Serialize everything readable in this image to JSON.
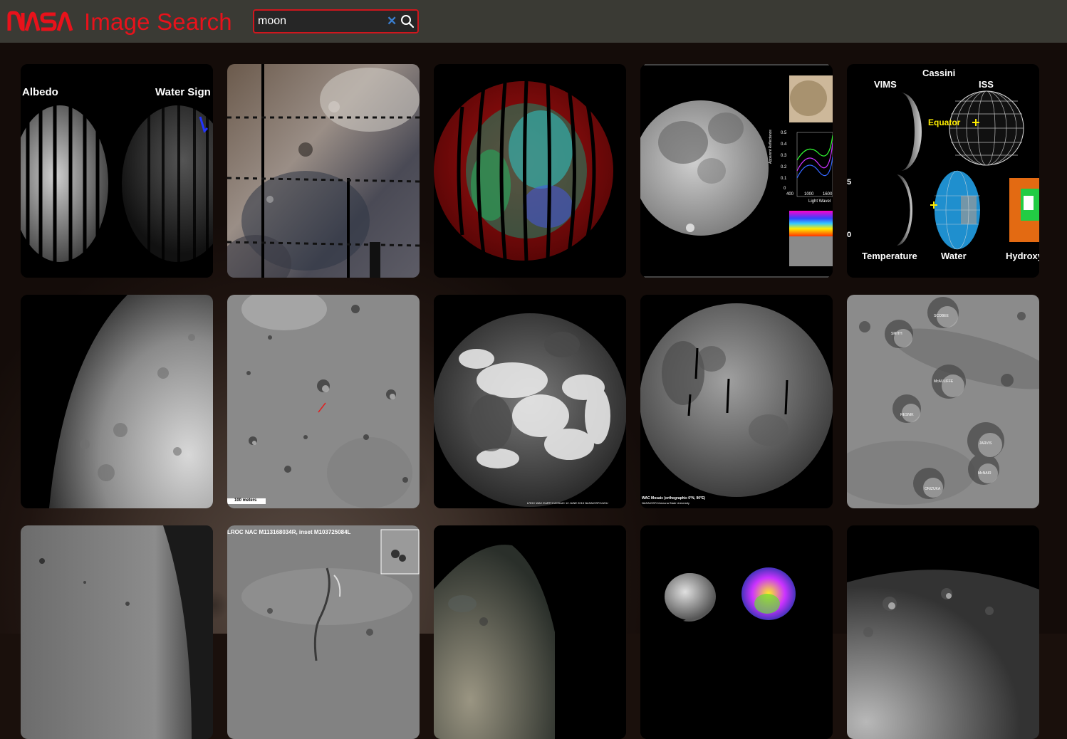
{
  "header": {
    "logo_text": "NASA",
    "title": "Image Search",
    "brand_color": "#e8121b"
  },
  "search": {
    "value": "moon",
    "clear_icon": "close-icon",
    "search_icon": "search-icon"
  },
  "results": {
    "tile1": {
      "label_left": "Albedo",
      "label_right": "Water Sign"
    },
    "tile4": {
      "axis_y": "Apparent Reflectance",
      "axis_x": "Light Wavel",
      "ticks_x": [
        "400",
        "1000",
        "1600"
      ],
      "ticks_y": [
        "0.5",
        "0.4",
        "0.3",
        "0.2",
        "0.1",
        "0"
      ]
    },
    "tile5": {
      "title": "Cassini",
      "vims": "VIMS",
      "iss": "ISS",
      "equator": "Equator",
      "temperature": "Temperature",
      "water": "Water",
      "hydroxyl": "Hydroxy",
      "num5": "5",
      "num0": "0"
    },
    "tile7": {
      "scale": "100 meters"
    },
    "tile8": {
      "credit": "LROC WAC EARTH MOSAIC 12 JUNE 2015 NASA/GSFC/ASU"
    },
    "tile9": {
      "credit_line1": "WAC Mosaic (orthographic 0°N, 90°E)",
      "credit_line2": "NASA/GSFC/Arizona State University"
    },
    "tile10": {
      "craters": [
        "SCOBEE",
        "SMITH",
        "McAULIFFE",
        "RESNIK",
        "JARVIS",
        "McNAIR",
        "ONIZUKA"
      ]
    },
    "tile12": {
      "caption": "LROC NAC M113168034R, inset M103725084L"
    }
  }
}
